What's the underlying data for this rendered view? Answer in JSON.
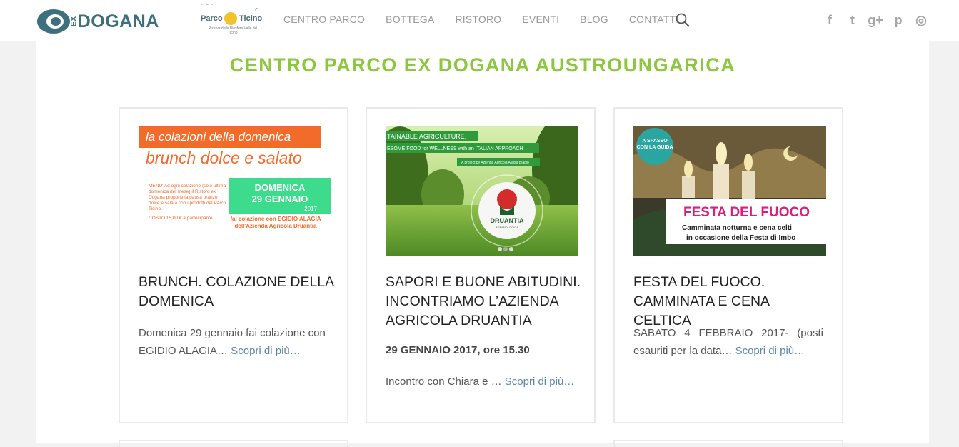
{
  "header": {
    "logo_ex": "EX",
    "logo_text": "DOGANA",
    "parco_name_1": "Parco",
    "parco_name_2": "Ticino",
    "parco_sub": "Riserva della Biosfera Valle del Ticino",
    "nav": [
      "CENTRO PARCO",
      "BOTTEGA",
      "RISTORO",
      "EVENTI",
      "BLOG",
      "CONTATTI"
    ],
    "socials": [
      "facebook-icon",
      "twitter-icon",
      "google-plus-icon",
      "pinterest-icon",
      "instagram-icon"
    ],
    "social_glyphs": [
      "f",
      "t",
      "g+",
      "p",
      "◎"
    ]
  },
  "page": {
    "title": "CENTRO PARCO EX DOGANA AUSTROUNGARICA",
    "accent": "#8dc63f"
  },
  "cards": [
    {
      "img": {
        "line1": "la colazioni della domenica",
        "line2": "brunch dolce e salato",
        "badge_day": "DOMENICA",
        "badge_date": "29 GENNAIO",
        "badge_year": "2017",
        "menu": "MENU' Ad ogni colazione (solo ultima domenica del mese) il Ristoro ex Dogana propone la pausa pranzo dolce e salata con i prodotti del Parco Ticino.",
        "costo": "COSTO 15,00 € a partecipante",
        "with": "fai colazione con EGIDIO ALAGIA dell'Azienda Agricola Druantia"
      },
      "title": "BRUNCH. COLAZIONE DELLA DOMENICA",
      "excerpt": "Domenica 29 gennaio fai colazione con EGIDIO ALAGIA…",
      "more": "Scopri di più…"
    },
    {
      "img": {
        "banner1": "TAINABLE AGRICULTURE,",
        "banner2": "ESOME FOOD for WELLNESS with an ITALIAN APPROACH",
        "banner3": "A project by Azienda Agricola Alagia Biagio",
        "brand": "DRUANTIA",
        "brand_sub": "AGRIBIOLOGICA"
      },
      "title": "SAPORI E BUONE ABITUDINI. INCONTRIAMO L’AZIENDA AGRICOLA DRUANTIA",
      "date": "29 GENNAIO 2017, ore 15.30",
      "excerpt": "Incontro con Chiara e …",
      "more": "Scopri di più…"
    },
    {
      "img": {
        "badge1": "A SPASSO",
        "badge2": "CON LA GUIDA",
        "headline": "FESTA DEL FUOCO",
        "sub1": "Camminata notturna e cena celti",
        "sub2": "in occasione della Festa di Imbo"
      },
      "title": "FESTA DEL FUOCO. CAMMINATA E CENA CELTICA",
      "excerpt": "SABATO 4 FEBBRAIO 2017- (posti esauriti per la data…",
      "more": "Scopri di più…"
    }
  ]
}
